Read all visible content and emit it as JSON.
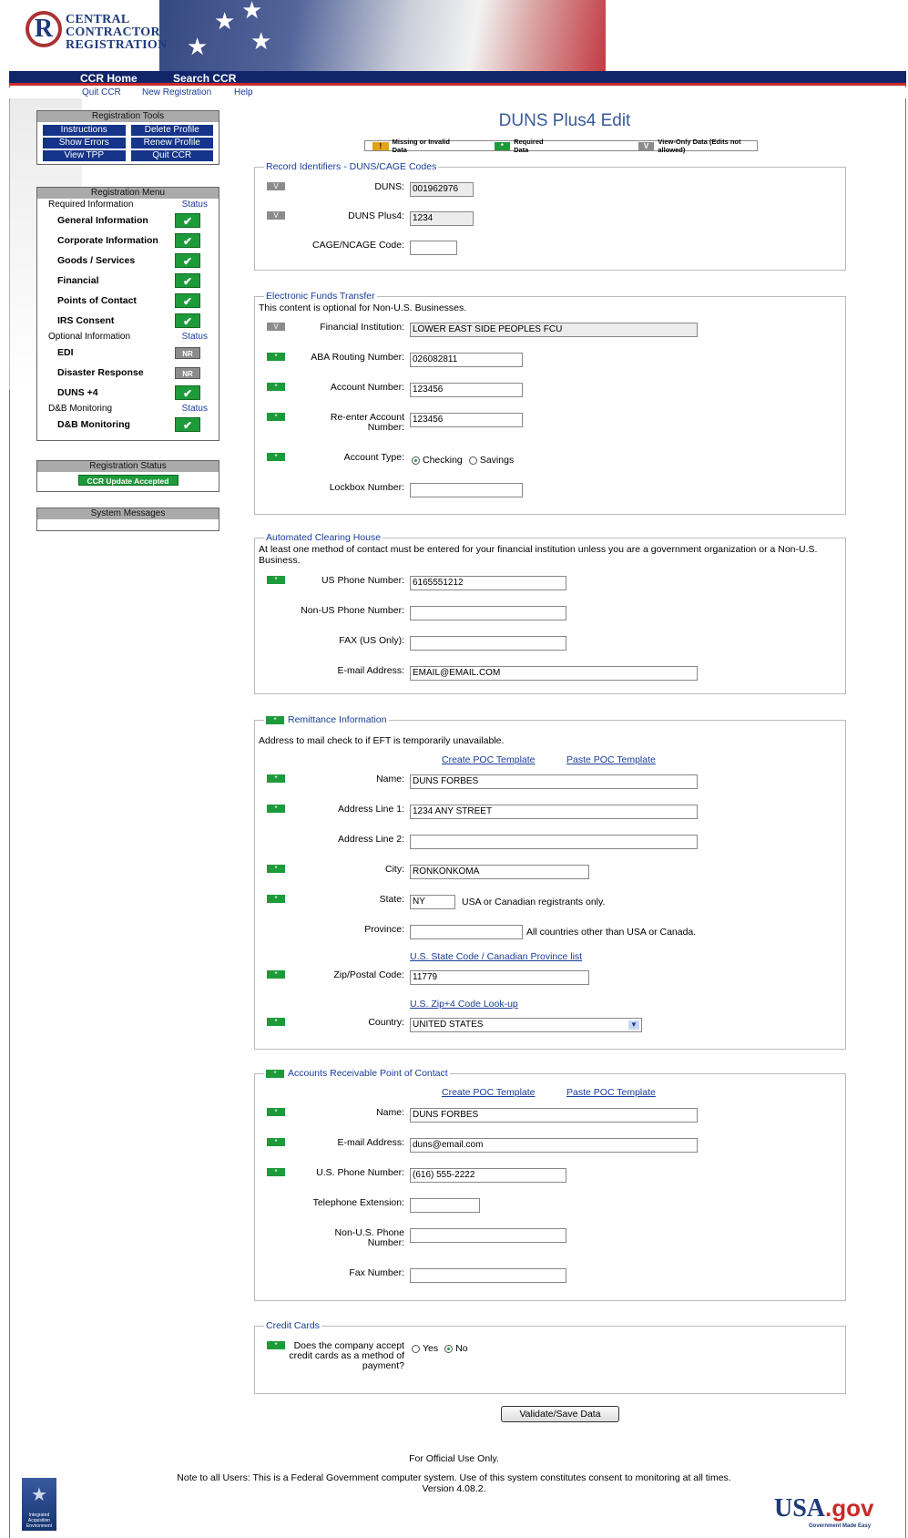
{
  "header": {
    "logo_letter": "R",
    "logo_line1": "Central",
    "logo_line2": "Contractor",
    "logo_line3": "Registration",
    "nav_home": "CCR Home",
    "nav_search": "Search CCR",
    "sub_quit": "Quit CCR",
    "sub_new": "New Registration",
    "sub_help": "Help"
  },
  "tools": {
    "title": "Registration Tools",
    "buttons": [
      "Instructions",
      "Delete Profile",
      "Show Errors",
      "Renew Profile",
      "View TPP",
      "Quit CCR"
    ]
  },
  "menu": {
    "title": "Registration Menu",
    "required_label": "Required Information",
    "optional_label": "Optional Information",
    "dnb_label": "D&B Monitoring",
    "status_label": "Status",
    "required_items": [
      "General Information",
      "Corporate Information",
      "Goods / Services",
      "Financial",
      "Points of Contact",
      "IRS Consent"
    ],
    "optional_items": [
      "EDI",
      "Disaster Response",
      "DUNS +4"
    ],
    "optional_status": [
      "NR",
      "NR",
      "check"
    ],
    "dnb_items": [
      "D&B Monitoring"
    ]
  },
  "reg_status": {
    "title": "Registration Status",
    "badge": "CCR Update Accepted"
  },
  "system_messages": {
    "title": "System Messages"
  },
  "page": {
    "title": "DUNS Plus4 Edit",
    "legend_missing": "Missing or Invalid Data",
    "legend_required": "Required Data",
    "legend_view": "View-Only Data (Edits not allowed)",
    "legend_missing_icon": "!",
    "legend_required_icon": "*",
    "legend_view_icon": "V"
  },
  "record": {
    "title": "Record Identifiers - DUNS/CAGE Codes",
    "duns_label": "DUNS:",
    "duns": "001962976",
    "plus4_label": "DUNS Plus4:",
    "plus4": "1234",
    "cage_label": "CAGE/NCAGE Code:",
    "cage": ""
  },
  "eft": {
    "title": "Electronic Funds Transfer",
    "note": "This content is optional for Non-U.S. Businesses.",
    "fi_label": "Financial Institution:",
    "fi": "LOWER EAST SIDE PEOPLES FCU",
    "aba_label": "ABA Routing Number:",
    "aba": "026082811",
    "acct_label": "Account Number:",
    "acct": "123456",
    "reacct_label": "Re-enter Account Number:",
    "reacct": "123456",
    "type_label": "Account Type:",
    "type_checking": "Checking",
    "type_savings": "Savings",
    "lockbox_label": "Lockbox Number:",
    "lockbox": ""
  },
  "ach": {
    "title": "Automated Clearing House",
    "note": "At least one method of contact must be entered for your financial institution unless you are a government organization or a Non-U.S. Business.",
    "us_phone_label": "US Phone Number:",
    "us_phone": "6165551212",
    "nonus_phone_label": "Non-US Phone Number:",
    "nonus_phone": "",
    "fax_label": "FAX (US Only):",
    "fax": "",
    "email_label": "E-mail Address:",
    "email": "EMAIL@EMAIL.COM"
  },
  "remit": {
    "title": "Remittance Information",
    "note": "Address to mail check to if EFT is temporarily unavailable.",
    "create_poc": "Create POC Template",
    "paste_poc": "Paste POC Template",
    "name_label": "Name:",
    "name": "DUNS FORBES",
    "addr1_label": "Address Line 1:",
    "addr1": "1234 ANY STREET",
    "addr2_label": "Address Line 2:",
    "addr2": "",
    "city_label": "City:",
    "city": "RONKONKOMA",
    "state_label": "State:",
    "state": "NY",
    "state_hint": "USA or Canadian registrants only.",
    "province_label": "Province:",
    "province": "",
    "province_hint": "All countries other than USA or Canada.",
    "state_list_link": "U.S. State Code / Canadian Province list",
    "zip_label": "Zip/Postal Code:",
    "zip": "11779",
    "zip_lookup_link": "U.S. Zip+4 Code Look-up",
    "country_label": "Country:",
    "country": "UNITED STATES"
  },
  "ar_poc": {
    "title": "Accounts Receivable Point of Contact",
    "create_poc": "Create POC Template",
    "paste_poc": "Paste POC Template",
    "name_label": "Name:",
    "name": "DUNS FORBES",
    "email_label": "E-mail Address:",
    "email": "duns@email.com",
    "phone_label": "U.S. Phone Number:",
    "phone": "(616) 555-2222",
    "ext_label": "Telephone Extension:",
    "ext": "",
    "nonus_label": "Non-U.S. Phone Number:",
    "nonus": "",
    "fax_label": "Fax Number:",
    "fax": ""
  },
  "credit": {
    "title": "Credit Cards",
    "question": "Does the company accept credit cards as a method of payment?",
    "yes": "Yes",
    "no": "No"
  },
  "actions": {
    "save": "Validate/Save Data"
  },
  "footer": {
    "official": "For Official Use Only.",
    "notice": "Note to all Users: This is a Federal Government computer system. Use of this system constitutes consent to monitoring at all times.",
    "version": "Version 4.08.2.",
    "iae_text": "Integrated Acquisition Environment",
    "usagov_usa": "USA",
    "usagov_gov": ".gov",
    "usagov_tag": "Government Made Easy"
  },
  "colors": {
    "brand_navy": "#10256a",
    "required_green": "#1d9a3a",
    "missing_orange": "#e3a21a",
    "view_gray": "#8c8c8c",
    "link_blue": "#1a3c9a"
  }
}
